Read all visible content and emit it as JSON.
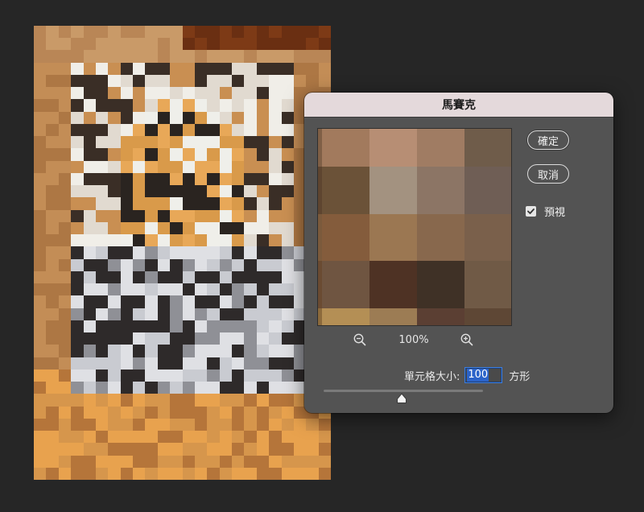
{
  "dialog": {
    "title": "馬賽克",
    "ok_label": "確定",
    "cancel_label": "取消",
    "preview_label": "預視",
    "preview_checked": true,
    "zoom_level": "100%",
    "cell_size_label": "單元格大小:",
    "cell_size_value": "100",
    "cell_size_unit": "方形",
    "slider_value": 100
  },
  "icons": {
    "zoom_out": "zoom-out-icon",
    "zoom_in": "zoom-in-icon",
    "checkmark": "checkmark-icon",
    "slider_thumb": "slider-thumb-icon"
  },
  "colors": {
    "app_background": "#262626",
    "dialog_background": "#535353",
    "titlebar": "#e4d9db",
    "selection_blue": "#2b63c9",
    "focus_ring": "#3d7fe0"
  },
  "preview_mosaic_colors": [
    "#7f5f46",
    "#a27a5d",
    "#b78e74",
    "#a07c63",
    "#6f5c4a",
    "#5e4530",
    "#6b5238",
    "#a39280",
    "#8c7565",
    "#6f5e55",
    "#7b5a3c",
    "#845c3c",
    "#9b7752",
    "#88684d",
    "#7a604b",
    "#6a4b32",
    "#6f5541",
    "#4e3224",
    "#3f3126",
    "#705a46",
    "#8c6a3c",
    "#b48f55",
    "#9c7c54",
    "#5b3f33",
    "#5e4735"
  ]
}
